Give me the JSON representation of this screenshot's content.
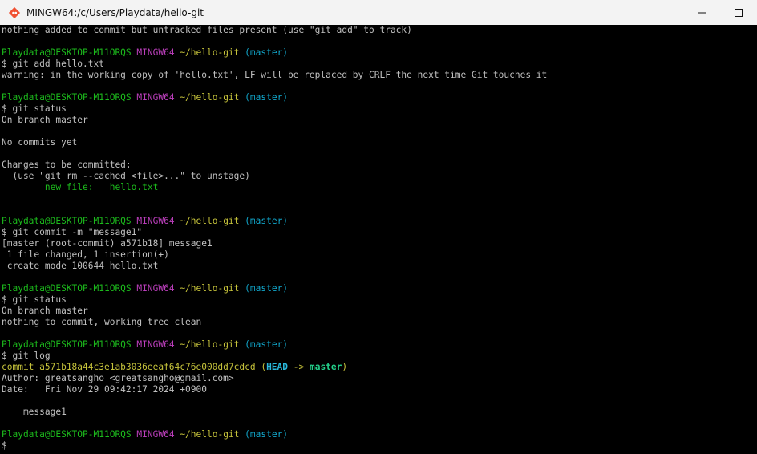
{
  "window": {
    "title": "MINGW64:/c/Users/Playdata/hello-git",
    "icon": "git-bash-icon",
    "controls": [
      "minimize-icon",
      "maximize-icon"
    ]
  },
  "colors": {
    "user_host": "#1cba1c",
    "shell": "#bc3fbc",
    "path": "#c7c43b",
    "branch": "#11a8cd",
    "default_text": "#c0c0c0",
    "background": "#000000"
  },
  "prompt": {
    "user_host": "Playdata@DESKTOP-M11ORQS",
    "shell": "MINGW64",
    "path": "~/hello-git",
    "branch": "(master)",
    "symbol": "$"
  },
  "terminal": {
    "l0": "nothing added to commit but untracked files present (use \"git add\" to track)",
    "cmd1": "$ git add hello.txt",
    "warn1": "warning: in the working copy of 'hello.txt', LF will be replaced by CRLF the next time Git touches it",
    "cmd2": "$ git status",
    "s1": "On branch master",
    "s2": "No commits yet",
    "s3": "Changes to be committed:",
    "s4": "  (use \"git rm --cached <file>...\" to unstage)",
    "s5": "        new file:   hello.txt",
    "cmd3": "$ git commit -m \"message1\"",
    "c1": "[master (root-commit) a571b18] message1",
    "c2": " 1 file changed, 1 insertion(+)",
    "c3": " create mode 100644 hello.txt",
    "cmd4": "$ git status",
    "t1": "On branch master",
    "t2": "nothing to commit, working tree clean",
    "cmd5": "$ git log",
    "log_commit": "commit a571b18a44c3e1ab3036eeaf64c76e000dd7cdcd",
    "log_open": " (",
    "log_head": "HEAD",
    "log_arrow": " -> ",
    "log_master": "master",
    "log_close": ")",
    "log_author": "Author: greatsangho <greatsangho@gmail.com>",
    "log_date": "Date:   Fri Nov 29 09:42:17 2024 +0900",
    "log_msg": "    message1",
    "final_prompt": "$"
  }
}
